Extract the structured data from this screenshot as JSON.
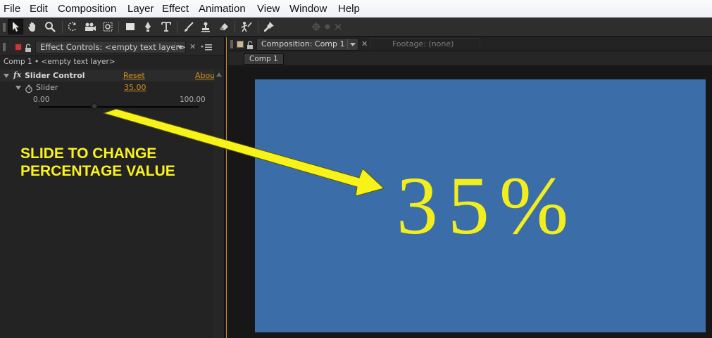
{
  "menu": {
    "items": [
      "File",
      "Edit",
      "Composition",
      "Layer",
      "Effect",
      "Animation",
      "View",
      "Window",
      "Help"
    ]
  },
  "tools": [
    "selection-tool-icon",
    "hand-tool-icon",
    "zoom-tool-icon",
    "rotation-tool-icon",
    "camera-tool-icon",
    "pan-behind-tool-icon",
    "rectangle-tool-icon",
    "pen-tool-icon",
    "type-tool-icon",
    "brush-tool-icon",
    "clone-stamp-tool-icon",
    "eraser-tool-icon",
    "roto-brush-tool-icon",
    "puppet-pin-tool-icon"
  ],
  "effect_controls": {
    "tab_label": "Effect Controls: <empty text layer>",
    "breadcrumb": "Comp 1 • <empty text layer>",
    "effect_name": "Slider Control",
    "reset_label": "Reset",
    "about_label": "Abou",
    "property_name": "Slider",
    "property_value": "35.00",
    "range_min": "0.00",
    "range_max": "100.00",
    "slider_fraction": 0.35
  },
  "composition": {
    "tab_label": "Composition: Comp 1",
    "footage_tab_label": "Footage: (none)",
    "comp_name": "Comp 1",
    "canvas_text": "35%",
    "canvas_color": "#3b6ea8",
    "text_color": "#f2ee1e"
  },
  "annotation": {
    "line1": "SLIDE TO CHANGE",
    "line2": "PERCENTAGE VALUE",
    "color": "#fbf31d"
  }
}
